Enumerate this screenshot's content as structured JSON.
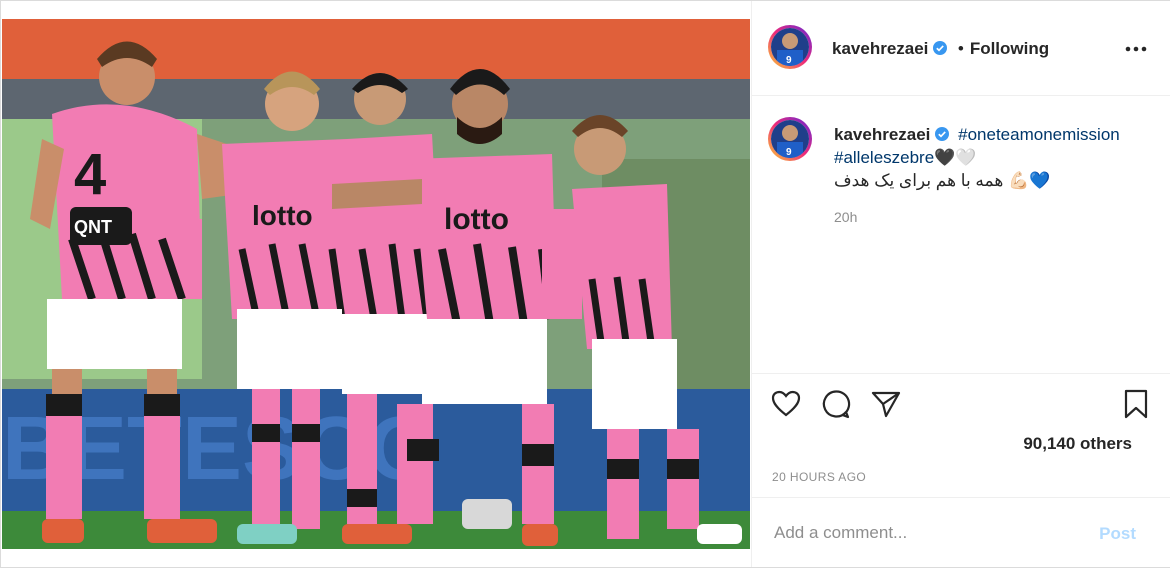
{
  "post": {
    "username": "kavehrezaei",
    "follow_status": "Following",
    "separator": "•",
    "more_label": "•••"
  },
  "caption": {
    "username": "kavehrezaei",
    "hashtag1": "#oneteamonemission",
    "hashtag2": "#alleleszebre",
    "emoji_line1": "🖤🤍",
    "persian_text": "همه با هم برای یک هدف",
    "emoji_line2": "💪🏻💙",
    "time": "20h"
  },
  "actions": {
    "likes": "90,140 others",
    "posted_ago": "20 HOURS AGO"
  },
  "comment": {
    "placeholder": "Add a comment...",
    "post_label": "Post"
  },
  "photo": {
    "jersey_number": "4",
    "sponsor": "lotto",
    "sleeve_sponsor": "QNT",
    "banner_text": "BETESCO"
  },
  "colors": {
    "verified": "#3897f0",
    "link": "#00376b",
    "post_disabled": "#b3dbff",
    "kit_pink": "#f27cb3"
  }
}
